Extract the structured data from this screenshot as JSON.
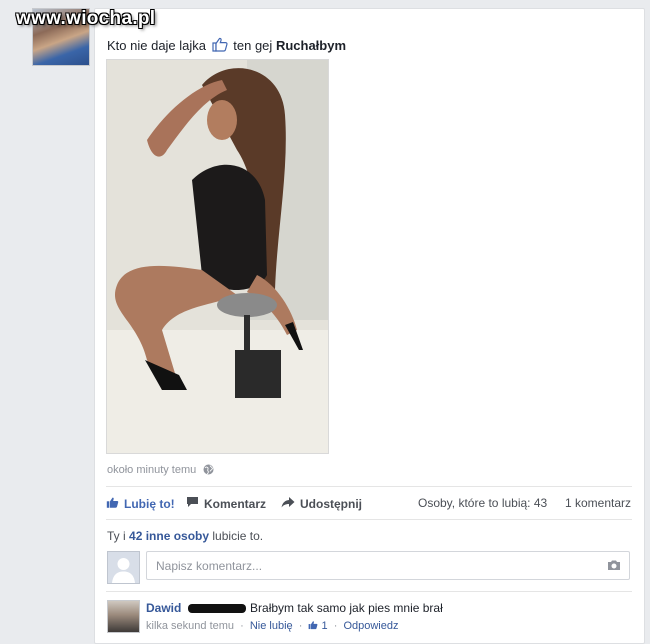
{
  "watermark": "www.wiocha.pl",
  "post": {
    "author": "",
    "text_before": "Kto nie daje lajka",
    "text_after": "ten gej",
    "text_bold": "Ruchałbym",
    "timestamp": "około minuty temu"
  },
  "actions": {
    "like": "Lubię to!",
    "comment": "Komentarz",
    "share": "Udostępnij"
  },
  "stats": {
    "likes": "Osoby, które to lubią: 43",
    "comments": "1 komentarz"
  },
  "like_summary": {
    "prefix": "Ty i",
    "count_link": "42 inne osoby",
    "suffix": "lubicie to."
  },
  "composer": {
    "placeholder": "Napisz komentarz..."
  },
  "comment": {
    "name": "Dawid",
    "text": "Brałbym tak samo jak pies mnie brał",
    "time": "kilka sekund temu",
    "unlike": "Nie lubię",
    "like_count": "1",
    "reply": "Odpowiedz"
  },
  "colors": {
    "link": "#365899",
    "like_active": "#4267b2",
    "meta": "#90949c",
    "background": "#e9ebee"
  },
  "icons": [
    "thumbs-up-icon",
    "comment-icon",
    "share-icon",
    "globe-icon",
    "camera-icon"
  ]
}
